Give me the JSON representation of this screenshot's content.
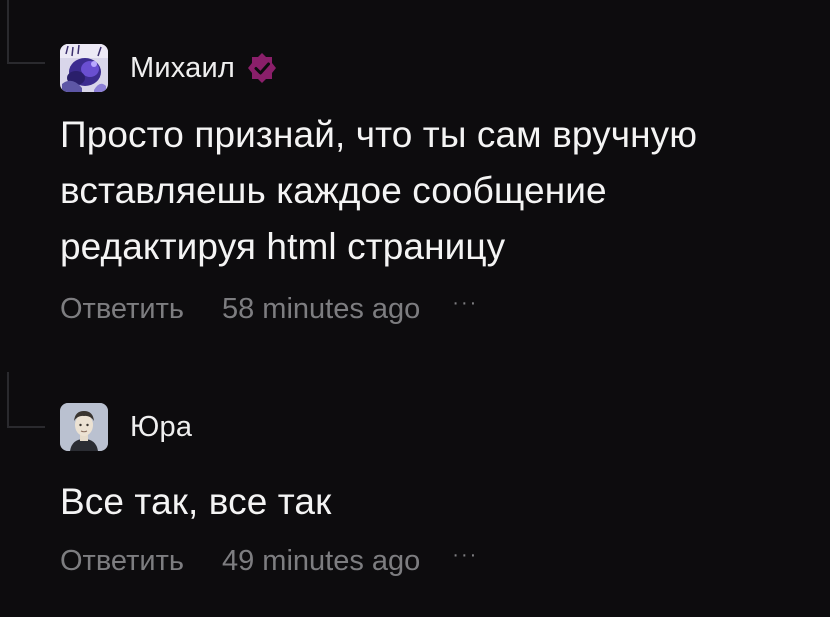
{
  "comments": [
    {
      "author": "Михаил",
      "avatar_icon": "purple-art-avatar",
      "verified_icon": "verified-badge-icon",
      "verified_color": "#8a1f6a",
      "text_lines": [
        "Просто признай, что ты сам вручную",
        "вставляешь каждое сообщение",
        "редактируя html страницу"
      ],
      "reply_label": "Ответить",
      "time": "58 minutes ago",
      "more_label": "···"
    },
    {
      "author": "Юра",
      "avatar_icon": "portrait-avatar",
      "text_lines": [
        "Все так, все так"
      ],
      "reply_label": "Ответить",
      "time": "49 minutes ago",
      "more_label": "···"
    }
  ],
  "colors": {
    "background": "#0d0c0e",
    "text": "#f4f4f4",
    "muted": "#7d7d80",
    "accent": "#8a1f6a"
  }
}
